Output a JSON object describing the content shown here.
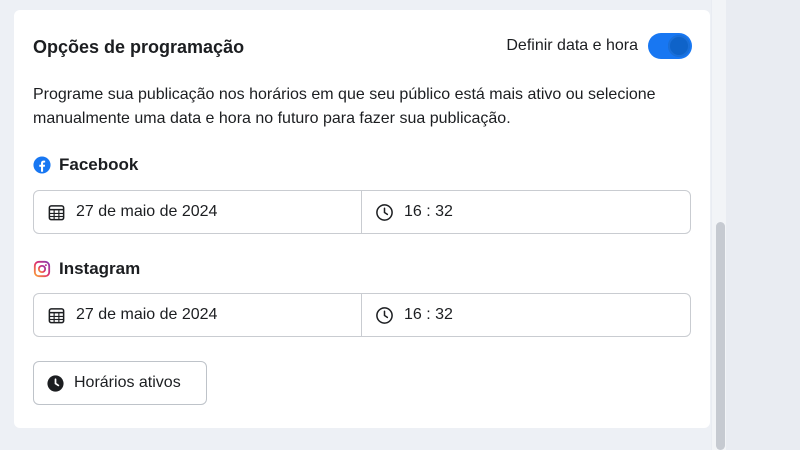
{
  "schedule": {
    "title": "Opções de programação",
    "toggle_label": "Definir data e hora",
    "toggle_on": true,
    "description": "Programe sua publicação nos horários em que seu público está mais ativo ou selecione manualmente uma data e hora no futuro para fazer sua publicação."
  },
  "facebook": {
    "label": "Facebook",
    "icon": "facebook-icon",
    "date": "27 de maio de 2024",
    "time": "16 : 32"
  },
  "instagram": {
    "label": "Instagram",
    "icon": "instagram-icon",
    "date": "27 de maio de 2024",
    "time": "16 : 32"
  },
  "active_times_button": {
    "label": "Horários ativos",
    "icon": "clock-filled-icon"
  },
  "colors": {
    "accent": "#1877f2",
    "background": "#edf0f5",
    "panel": "#ffffff",
    "border": "#c9ccd1"
  }
}
